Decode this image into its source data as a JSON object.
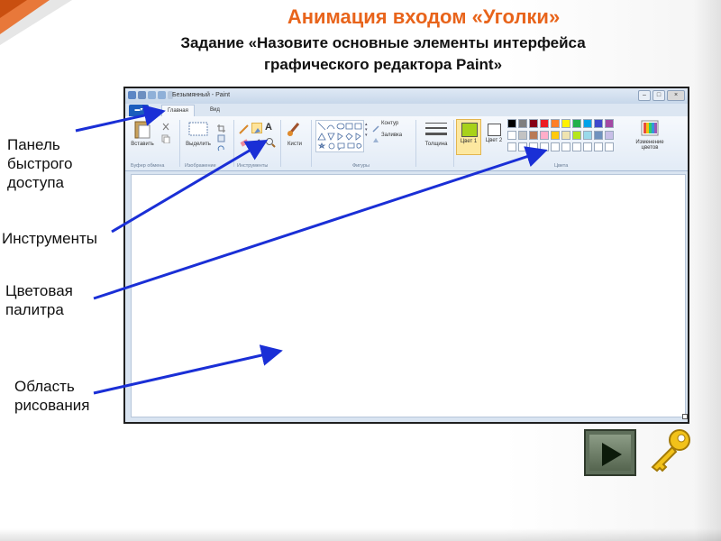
{
  "slide": {
    "title": "Анимация входом «Уголки»",
    "task_line1": "Задание «Назовите основные элементы интерфейса",
    "task_line2": "графического редактора Paint»",
    "labels": {
      "quick_access_line1": "Панель",
      "quick_access_line2": "быстрого",
      "quick_access_line3": "доступа",
      "tools": "Инструменты",
      "palette_line1": "Цветовая",
      "palette_line2": "палитра",
      "canvas_line1": "Область",
      "canvas_line2": "рисования"
    },
    "colors": {
      "title": "#e8641b",
      "arrow": "#1a2fd6",
      "accent_corner": "#e8641b"
    }
  },
  "paint": {
    "window_title": "Безымянный - Paint",
    "tabs": {
      "menu": "",
      "home": "Главная",
      "view": "Вид"
    },
    "ribbon": {
      "paste": "Вставить",
      "select": "Выделить",
      "brushes": "Кисти",
      "outline": "Контур",
      "fill": "Заливка",
      "size": "Толщина",
      "color1": "Цвет 1",
      "color2": "Цвет 2",
      "edit_colors": "Изменение цветов",
      "groups": {
        "clipboard": "Буфер обмена",
        "image": "Изображение",
        "tools": "Инструменты",
        "shapes": "Фигуры",
        "colors": "Цвета"
      }
    },
    "palette_row1": [
      "#000000",
      "#7f7f7f",
      "#880015",
      "#ed1c24",
      "#ff7f27",
      "#fff200",
      "#22b14c",
      "#00a2e8",
      "#3f48cc",
      "#a349a4"
    ],
    "palette_row2": [
      "#ffffff",
      "#c3c3c3",
      "#b97a57",
      "#ffaec9",
      "#ffc90e",
      "#efe4b0",
      "#b5e61d",
      "#99d9ea",
      "#7092be",
      "#c8bfe7"
    ],
    "palette_row3": [
      "#ffffff",
      "#ffffff",
      "#ffffff",
      "#ffffff",
      "#ffffff",
      "#ffffff",
      "#ffffff",
      "#ffffff",
      "#ffffff",
      "#ffffff"
    ],
    "color1_value": "#a8d21a",
    "color2_value": "#ffffff"
  }
}
